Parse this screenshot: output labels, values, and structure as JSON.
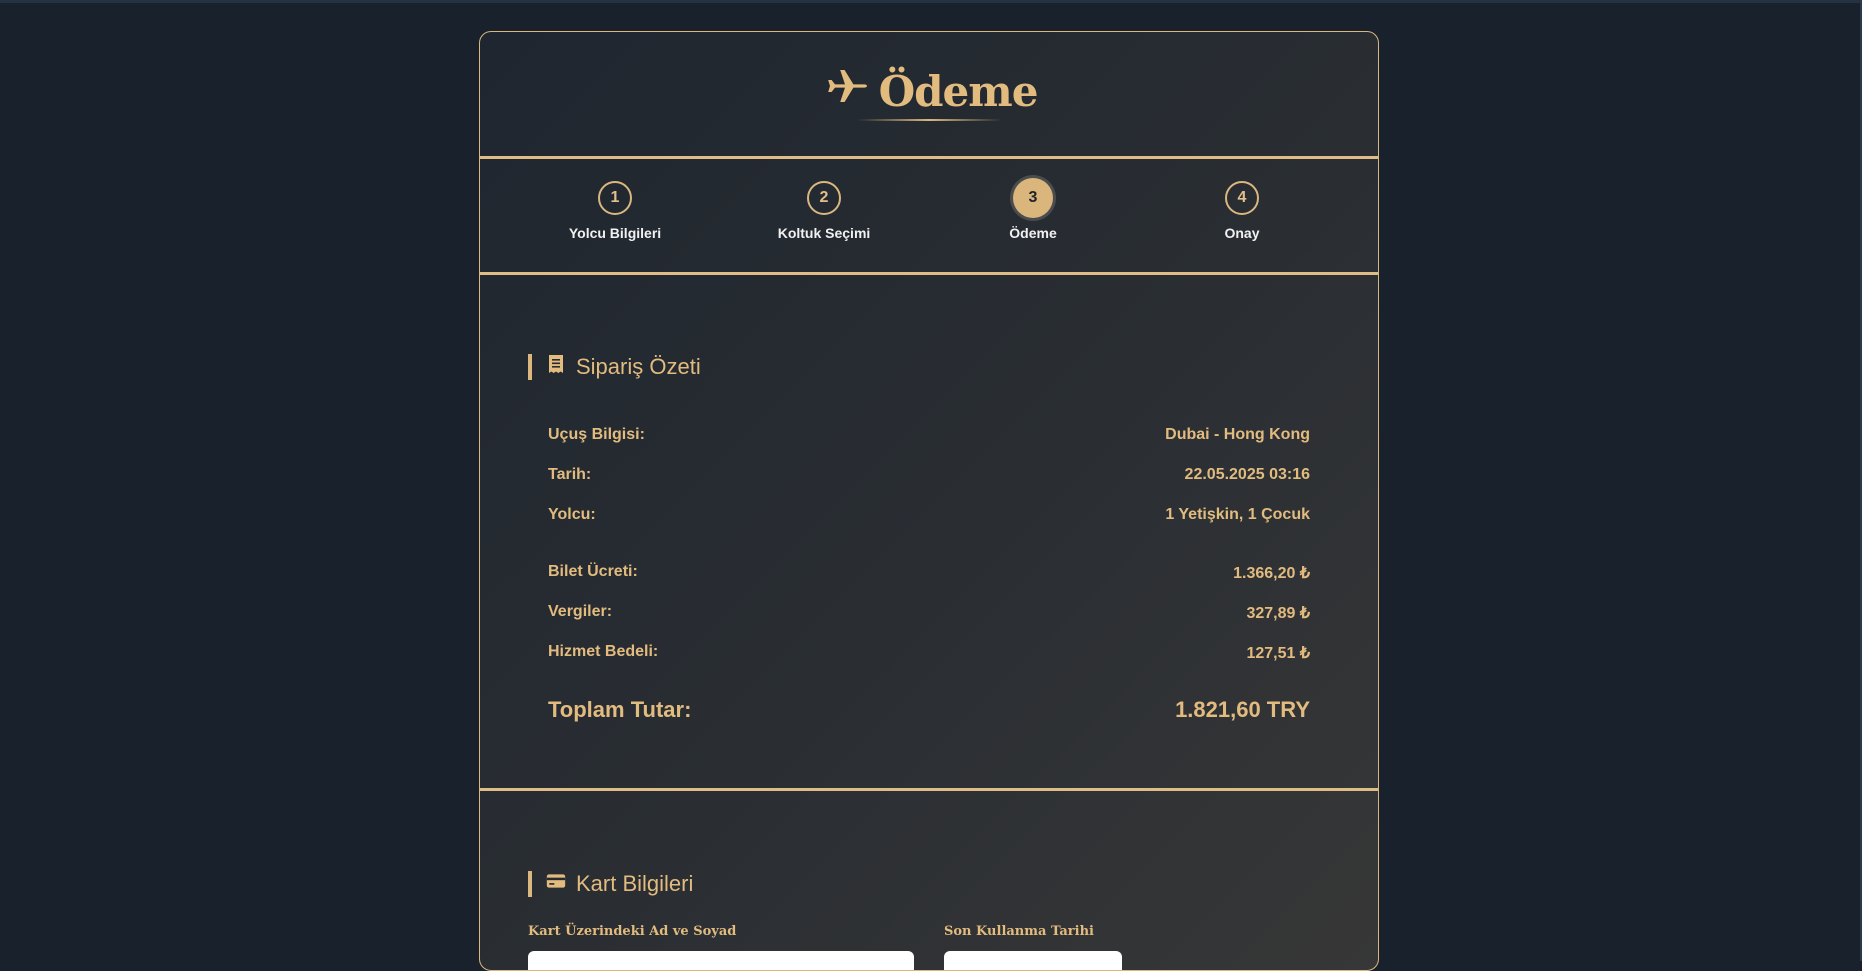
{
  "header": {
    "title": "Ödeme",
    "icon": "airplane-icon"
  },
  "steps": [
    {
      "number": "1",
      "label": "Yolcu Bilgileri",
      "active": false
    },
    {
      "number": "2",
      "label": "Koltuk Seçimi",
      "active": false
    },
    {
      "number": "3",
      "label": "Ödeme",
      "active": true
    },
    {
      "number": "4",
      "label": "Onay",
      "active": false
    }
  ],
  "summary": {
    "title": "Sipariş Özeti",
    "icon": "receipt-icon",
    "rows": [
      {
        "label": "Uçuş Bilgisi:",
        "value": "Dubai - Hong Kong"
      },
      {
        "label": "Tarih:",
        "value": "22.05.2025 03:16"
      },
      {
        "label": "Yolcu:",
        "value": "1 Yetişkin, 1 Çocuk"
      },
      {
        "label": "Bilet Ücreti:",
        "value": "1.366,20 ₺"
      },
      {
        "label": "Vergiler:",
        "value": "327,89 ₺"
      },
      {
        "label": "Hizmet Bedeli:",
        "value": "127,51 ₺"
      }
    ],
    "total": {
      "label": "Toplam Tutar:",
      "value": "1.821,60 TRY"
    }
  },
  "card": {
    "title": "Kart Bilgileri",
    "icon": "credit-card-icon",
    "name_label": "Kart Üzerindeki Ad ve Soyad",
    "expiry_label": "Son Kullanma Tarihi"
  },
  "colors": {
    "accent": "#d9b77f",
    "background": "#18212c"
  }
}
